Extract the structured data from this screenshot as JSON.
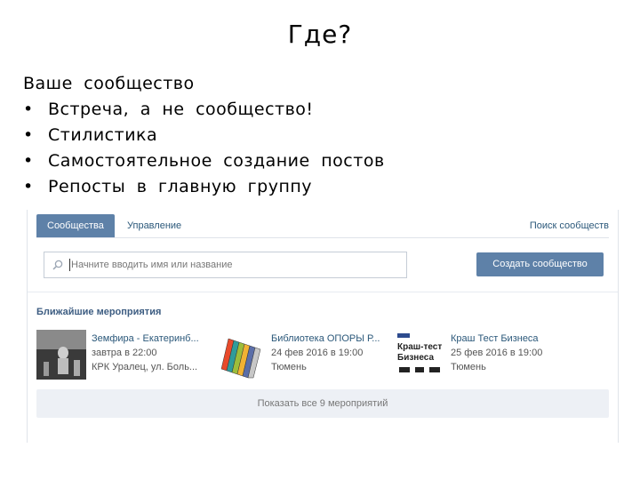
{
  "slide": {
    "title": "Где?",
    "lead": "Ваше сообщество",
    "bullets": [
      "Встреча, а не сообщество!",
      "Стилистика",
      "Самостоятельное создание постов",
      "Репосты в главную группу"
    ]
  },
  "vk": {
    "tabs": {
      "communities": "Сообщества",
      "management": "Управление",
      "find": "Поиск сообществ"
    },
    "search": {
      "placeholder": "Начните вводить имя или название"
    },
    "create_button": "Создать сообщество",
    "section_title": "Ближайшие мероприятия",
    "events": [
      {
        "name": "Земфира - Екатеринб...",
        "date": "завтра в 22:00",
        "place": "КРК Уралец, ул. Боль..."
      },
      {
        "name": "Библиотека ОПОРЫ Р...",
        "date": "24 фев 2016 в 19:00",
        "place": "Тюмень"
      },
      {
        "name": "Краш Тест Бизнеса",
        "date": "25 фев 2016 в 19:00",
        "place": "Тюмень",
        "thumb_text_1": "Краш-тест",
        "thumb_text_2": "Бизнеса"
      }
    ],
    "show_all": "Показать все 9 мероприятий",
    "colors": {
      "accent": "#5e81a8",
      "link": "#2b587a",
      "section": "#3d5d82",
      "panel": "#edf0f5"
    }
  }
}
